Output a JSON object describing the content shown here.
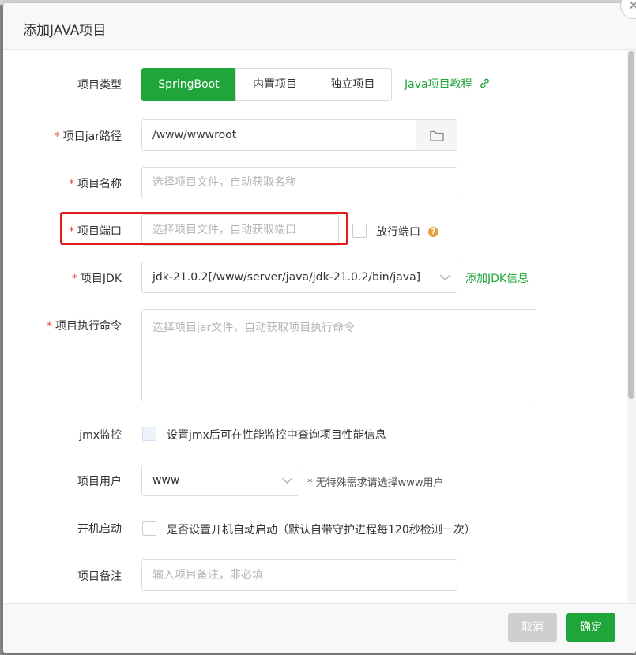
{
  "dialog": {
    "title": "添加JAVA项目",
    "close_label": "×"
  },
  "project_type": {
    "label": "项目类型",
    "options": [
      "SpringBoot",
      "内置项目",
      "独立项目"
    ],
    "selected": "SpringBoot",
    "tutorial_link": "Java项目教程"
  },
  "jar_path": {
    "required_mark": "*",
    "label": "项目jar路径",
    "value": "/www/wwwroot"
  },
  "project_name": {
    "required_mark": "*",
    "label": "项目名称",
    "placeholder": "选择项目文件，自动获取名称"
  },
  "project_port": {
    "required_mark": "*",
    "label": "项目端口",
    "placeholder": "选择项目文件，自动获取端口",
    "open_port_label": "放行端口",
    "help_glyph": "?"
  },
  "jdk": {
    "required_mark": "*",
    "label": "项目JDK",
    "value": "jdk-21.0.2[/www/server/java/jdk-21.0.2/bin/java]",
    "add_link": "添加JDK信息"
  },
  "command": {
    "required_mark": "*",
    "label": "项目执行命令",
    "placeholder": "选择项目jar文件，自动获取项目执行命令"
  },
  "jmx": {
    "label": "jmx监控",
    "text": "设置jmx后可在性能监控中查询项目性能信息"
  },
  "user": {
    "label": "项目用户",
    "value": "www",
    "hint": "* 无特殊需求请选择www用户"
  },
  "autostart": {
    "label": "开机启动",
    "text": "是否设置开机自动启动（默认自带守护进程每120秒检测一次）"
  },
  "remark": {
    "label": "项目备注",
    "placeholder": "输入项目备注，非必填"
  },
  "footer": {
    "cancel_label": "取消",
    "ok_label": "确定"
  },
  "colors": {
    "primary": "#20a53a",
    "highlight_border": "#e01b1b",
    "required": "#e64a4a"
  }
}
